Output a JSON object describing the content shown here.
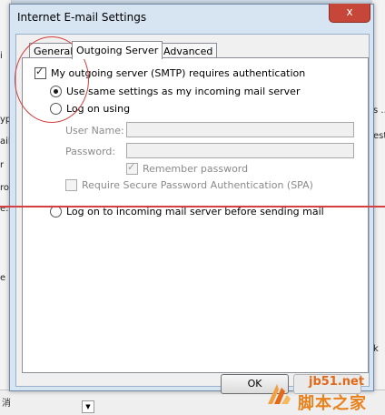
{
  "dialog": {
    "title": "Internet E-mail Settings",
    "close_label": "x",
    "tabs": [
      {
        "label": "General",
        "active": false
      },
      {
        "label": "Outgoing Server",
        "active": true
      },
      {
        "label": "Advanced",
        "active": false
      }
    ],
    "outgoing": {
      "requires_auth_label": "My outgoing server (SMTP) requires authentication",
      "requires_auth_checked": true,
      "use_same_label": "Use same settings as my incoming mail server",
      "log_on_using_label": "Log on using",
      "user_name_label": "User Name:",
      "user_name_value": "",
      "password_label": "Password:",
      "password_value": "",
      "remember_password_label": "Remember password",
      "remember_password_checked": true,
      "spa_label": "Require Secure Password Authentication (SPA)",
      "spa_checked": false,
      "log_on_incoming_label": "Log on to incoming mail server before sending mail",
      "selected_option": "use_same"
    },
    "ok_label": "OK"
  },
  "background_fragments": {
    "left": [
      "i",
      "ypi",
      "ail",
      "r",
      "ror",
      "e:",
      "e l",
      "消"
    ],
    "right": [
      "s ...",
      "est",
      "k"
    ]
  },
  "watermark": {
    "site": "jb51.net",
    "cn": "脚本之家"
  },
  "colors": {
    "annotation": "#d23c3c",
    "close_button": "#c7463a",
    "dialog_frame": "#d7e4f2"
  }
}
